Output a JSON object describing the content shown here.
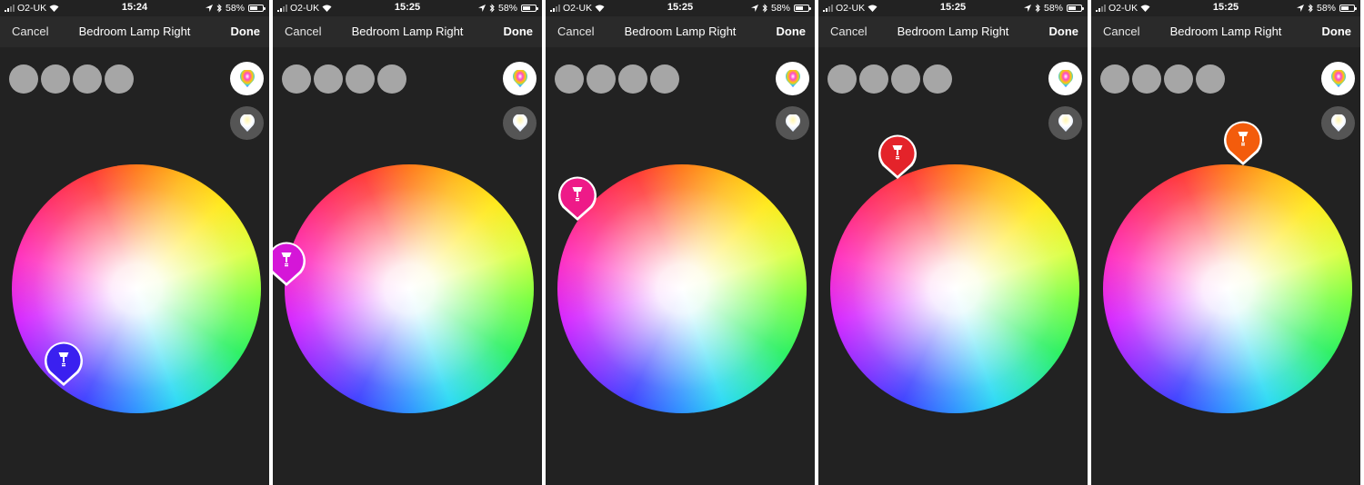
{
  "screens": [
    {
      "status": {
        "carrier": "O2-UK",
        "time": "15:24",
        "battery": "58%",
        "battery_level": 0.58
      },
      "nav": {
        "cancel": "Cancel",
        "title": "Bedroom Lamp Right",
        "done": "Done"
      },
      "selected_color": "#3a20f0"
    },
    {
      "status": {
        "carrier": "O2-UK",
        "time": "15:25",
        "battery": "58%",
        "battery_level": 0.58
      },
      "nav": {
        "cancel": "Cancel",
        "title": "Bedroom Lamp Right",
        "done": "Done"
      },
      "selected_color": "#d516d8"
    },
    {
      "status": {
        "carrier": "O2-UK",
        "time": "15:25",
        "battery": "58%",
        "battery_level": 0.58
      },
      "nav": {
        "cancel": "Cancel",
        "title": "Bedroom Lamp Right",
        "done": "Done"
      },
      "selected_color": "#ee1a88"
    },
    {
      "status": {
        "carrier": "O2-UK",
        "time": "15:25",
        "battery": "58%",
        "battery_level": 0.58
      },
      "nav": {
        "cancel": "Cancel",
        "title": "Bedroom Lamp Right",
        "done": "Done"
      },
      "selected_color": "#e4232a"
    },
    {
      "status": {
        "carrier": "O2-UK",
        "time": "15:25",
        "battery": "58%",
        "battery_level": 0.58
      },
      "nav": {
        "cancel": "Cancel",
        "title": "Bedroom Lamp Right",
        "done": "Done"
      },
      "selected_color": "#f35c0c"
    }
  ],
  "icons": {
    "wifi": "wifi-icon",
    "location": "location-arrow-icon",
    "bluetooth": "bluetooth-icon",
    "battery": "battery-icon",
    "color_mode": "color-palette-icon",
    "white_mode": "white-ambiance-icon",
    "lamp": "lamp-bulb-icon"
  }
}
